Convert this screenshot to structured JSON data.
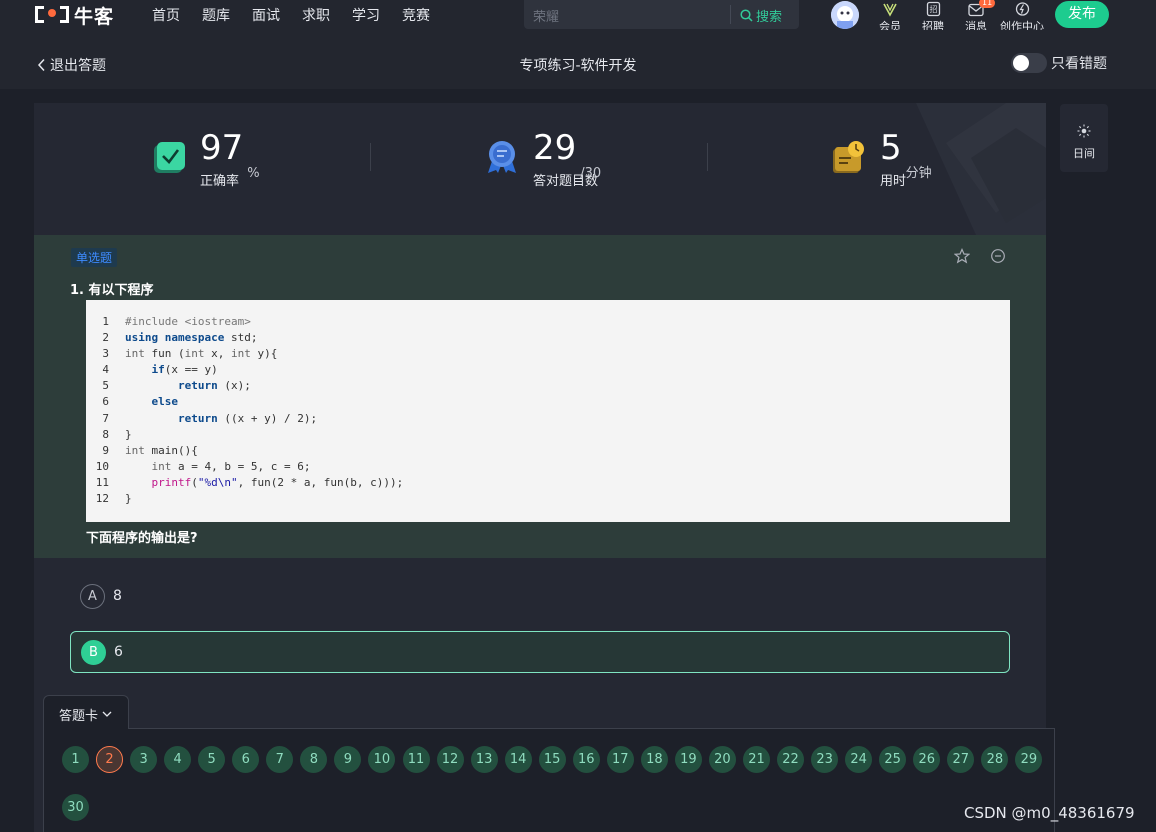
{
  "header": {
    "logo_text": "牛客",
    "nav": [
      "首页",
      "题库",
      "面试",
      "求职",
      "学习",
      "竞赛"
    ],
    "search_placeholder": "荣耀",
    "search_button": "搜索",
    "icons": [
      {
        "label": "会员",
        "icon": "vip-icon"
      },
      {
        "label": "招聘",
        "icon": "recruit-icon"
      },
      {
        "label": "消息",
        "icon": "message-icon",
        "badge": "11"
      },
      {
        "label": "创作中心",
        "icon": "creator-icon"
      }
    ],
    "publish_label": "发布"
  },
  "subbar": {
    "back_label": "退出答题",
    "title": "专项练习-软件开发",
    "toggle_label": "只看错题"
  },
  "stats": [
    {
      "value": "97",
      "unit": "%",
      "caption": "正确率",
      "icon": "accuracy-icon"
    },
    {
      "value": "29",
      "unit": "/30",
      "caption": "答对题目数",
      "icon": "medal-icon"
    },
    {
      "value": "5",
      "unit": "分钟",
      "caption": "用时",
      "icon": "clock-icon"
    }
  ],
  "side_panel": {
    "label": "日间",
    "icon": "sun-icon"
  },
  "question": {
    "type_tag": "单选题",
    "title": "1. 有以下程序",
    "tail": "下面程序的输出是?",
    "code_lines": [
      "#include <iostream>",
      "using namespace std;",
      "int fun (int x, int y){",
      "    if(x == y)",
      "        return (x);",
      "    else",
      "        return ((x + y) / 2);",
      "}",
      "int main(){",
      "    int a = 4, b = 5, c = 6;",
      "    printf(\"%d\\n\", fun(2 * a, fun(b, c)));",
      "}"
    ]
  },
  "options": [
    {
      "letter": "A",
      "text": "8",
      "selected": false
    },
    {
      "letter": "B",
      "text": "6",
      "selected": true
    }
  ],
  "answer_card": {
    "label": "答题卡",
    "numbers": [
      "1",
      "2",
      "3",
      "4",
      "5",
      "6",
      "7",
      "8",
      "9",
      "10",
      "11",
      "12",
      "13",
      "14",
      "15",
      "16",
      "17",
      "18",
      "19",
      "20",
      "21",
      "22",
      "23",
      "24",
      "25",
      "26",
      "27",
      "28",
      "29",
      "30"
    ],
    "wrong": [
      "2"
    ]
  },
  "watermark": "CSDN @m0_48361679"
}
